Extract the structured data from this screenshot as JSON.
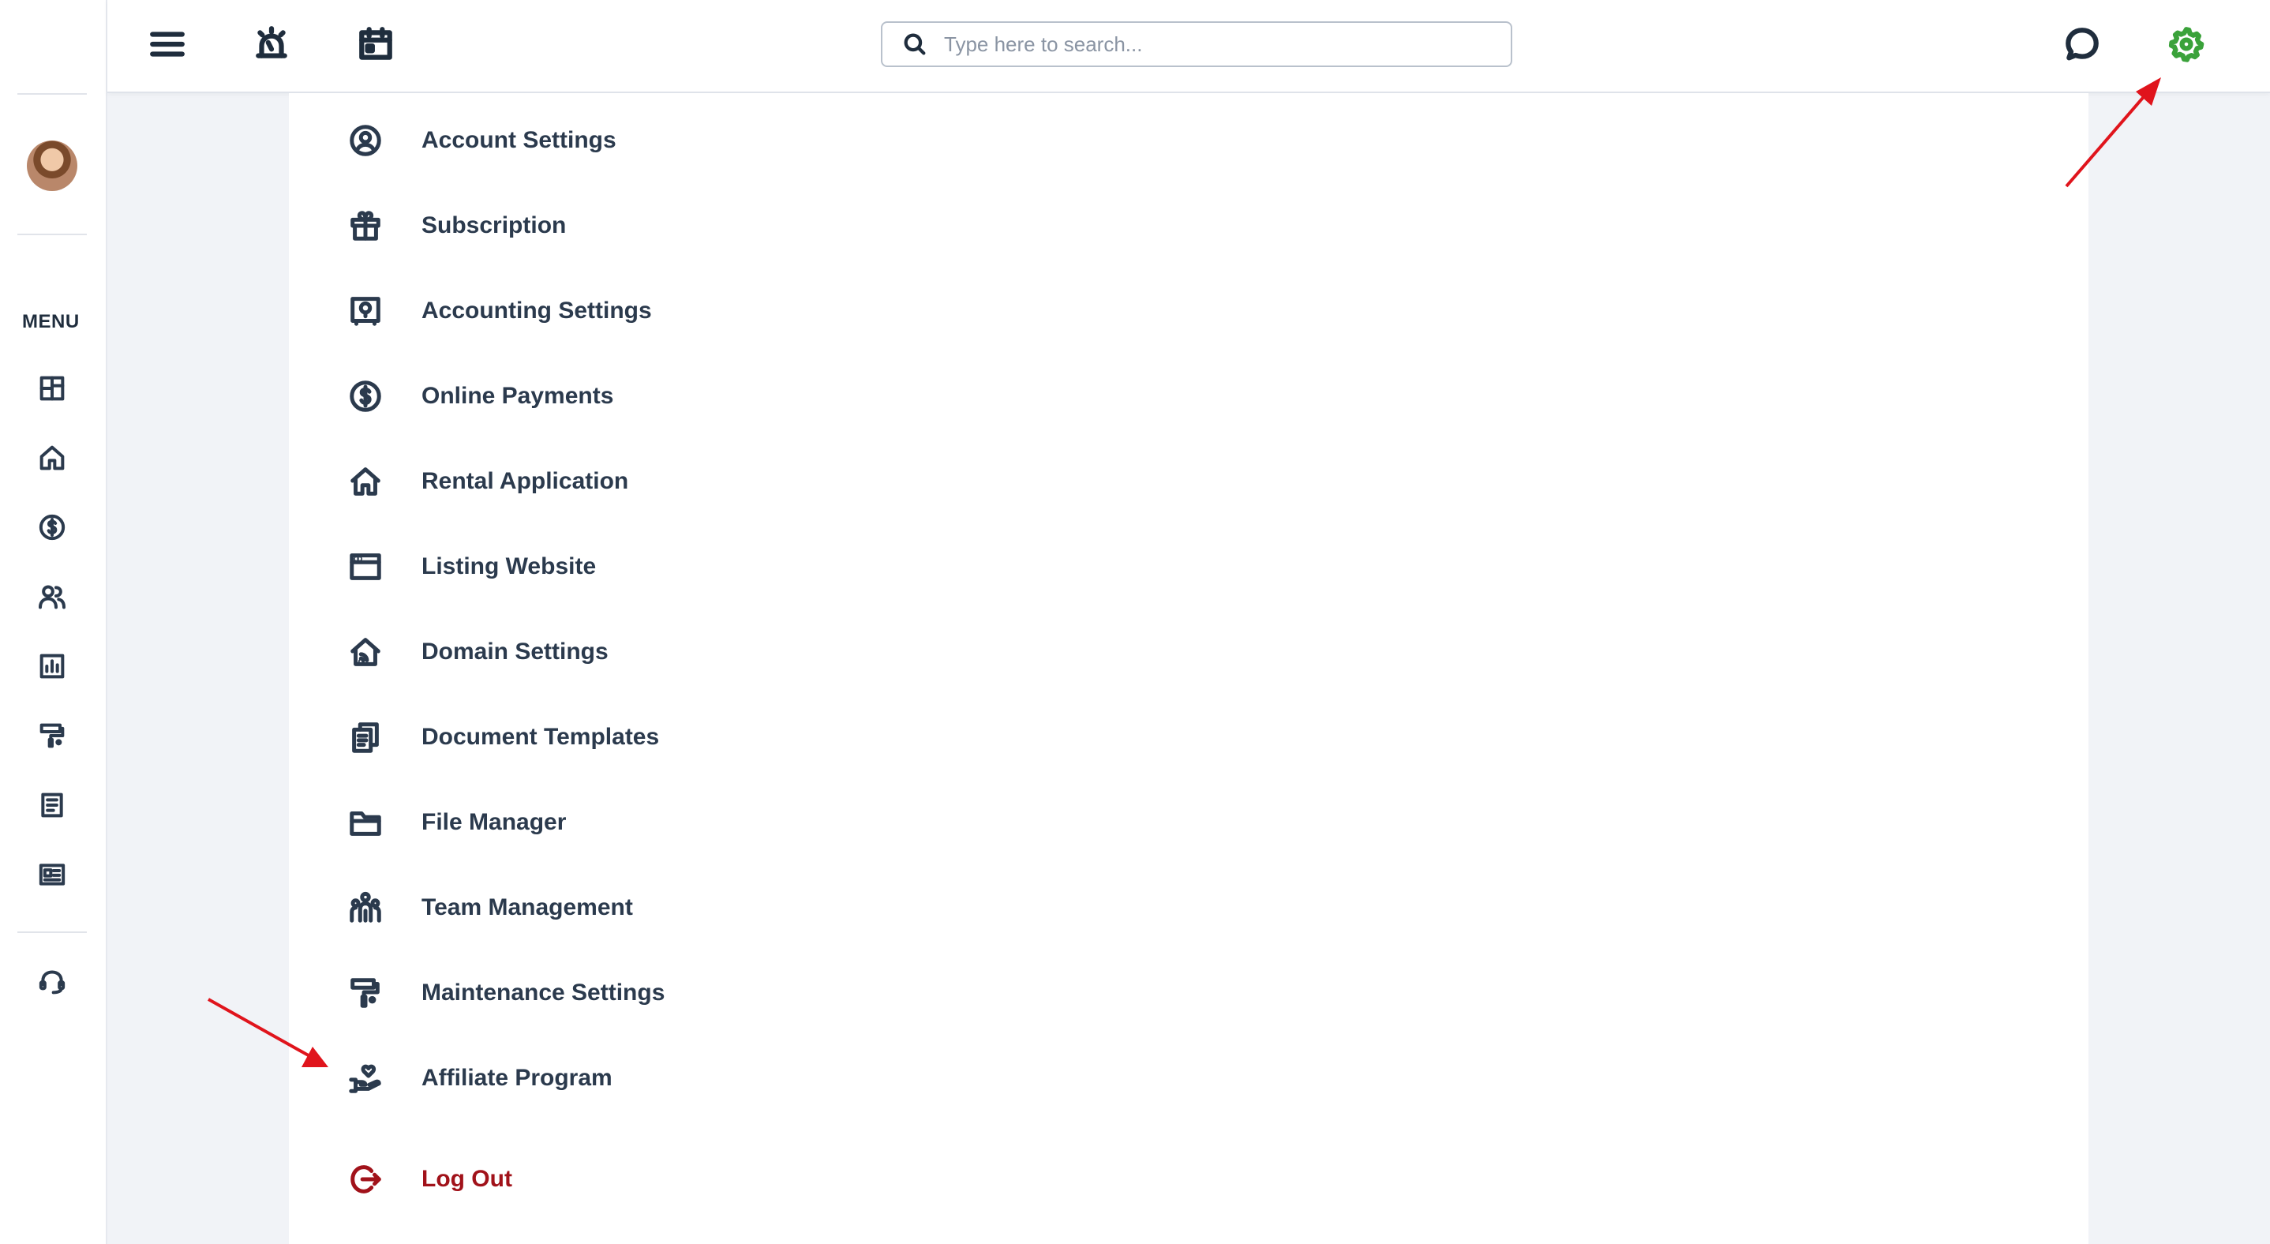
{
  "search": {
    "placeholder": "Type here to search..."
  },
  "sidebar": {
    "menu_label": "MENU",
    "icons": [
      "dashboard-icon",
      "home-icon",
      "dollar-icon",
      "users-icon",
      "report-icon",
      "paint-roller-icon",
      "document-icon",
      "listing-card-icon",
      "headset-icon"
    ]
  },
  "topbar": {
    "icons": [
      "hamburger-icon",
      "alarm-icon",
      "calendar-icon",
      "chat-icon",
      "gear-icon"
    ],
    "active_color": "#3aa23a"
  },
  "settings_menu": {
    "items": [
      {
        "label": "Account Settings",
        "icon": "user-circle-icon"
      },
      {
        "label": "Subscription",
        "icon": "gift-icon"
      },
      {
        "label": "Accounting Settings",
        "icon": "safe-icon"
      },
      {
        "label": "Online Payments",
        "icon": "dollar-circle-icon"
      },
      {
        "label": "Rental Application",
        "icon": "house-icon"
      },
      {
        "label": "Listing Website",
        "icon": "browser-window-icon"
      },
      {
        "label": "Domain Settings",
        "icon": "house-wifi-icon"
      },
      {
        "label": "Document Templates",
        "icon": "copy-document-icon"
      },
      {
        "label": "File Manager",
        "icon": "folder-icon"
      },
      {
        "label": "Team Management",
        "icon": "team-icon"
      },
      {
        "label": "Maintenance Settings",
        "icon": "paint-roller-icon"
      },
      {
        "label": "Affiliate Program",
        "icon": "hand-heart-icon"
      }
    ],
    "logout": {
      "label": "Log Out",
      "icon": "logout-icon",
      "color": "#a1121a"
    }
  },
  "colors": {
    "text": "#2b3a4d",
    "annotation_arrow": "#e0141c"
  }
}
